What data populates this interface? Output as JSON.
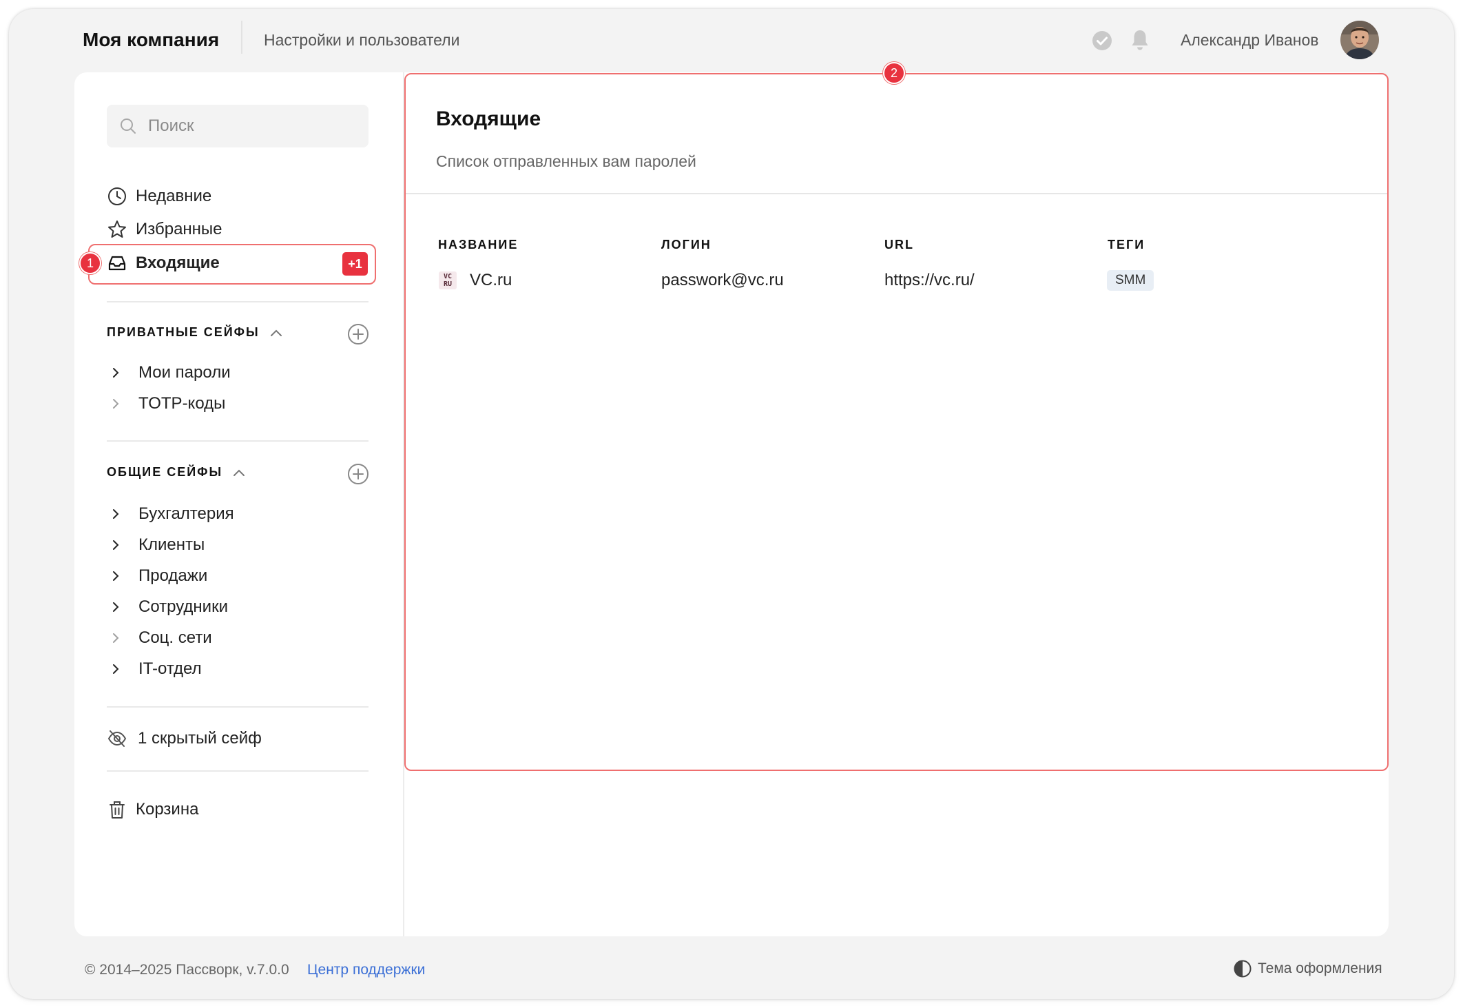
{
  "header": {
    "company": "Моя компания",
    "section": "Настройки и пользователи",
    "user_name": "Александр Иванов"
  },
  "search": {
    "placeholder": "Поиск"
  },
  "nav": {
    "recent": "Недавние",
    "favorites": "Избранные",
    "inbox": "Входящие",
    "inbox_badge": "+1"
  },
  "private_vaults": {
    "title": "ПРИВАТНЫЕ СЕЙФЫ",
    "items": [
      "Мои пароли",
      "TOTP-коды"
    ]
  },
  "shared_vaults": {
    "title": "ОБЩИЕ СЕЙФЫ",
    "items": [
      "Бухгалтерия",
      "Клиенты",
      "Продажи",
      "Сотрудники",
      "Соц. сети",
      "IT-отдел"
    ]
  },
  "hidden_vaults": "1 скрытый сейф",
  "trash": "Корзина",
  "markers": [
    "1",
    "2"
  ],
  "panel": {
    "title": "Входящие",
    "subtitle": "Список отправленных вам паролей",
    "columns": [
      "НАЗВАНИЕ",
      "ЛОГИН",
      "URL",
      "ТЕГИ"
    ],
    "rows": [
      {
        "icon_text": "VC RU",
        "name": "VC.ru",
        "login": "passwork@vc.ru",
        "url": "https://vc.ru/",
        "tag": "SMM"
      }
    ]
  },
  "footer": {
    "copyright": "© 2014–2025 Пассворк, v.7.0.0",
    "support": "Центр поддержки",
    "theme": "Тема оформления"
  },
  "colors": {
    "accent_red": "#e8323f",
    "highlight_border": "#ef6f6f",
    "link_blue": "#3b6fd6"
  }
}
